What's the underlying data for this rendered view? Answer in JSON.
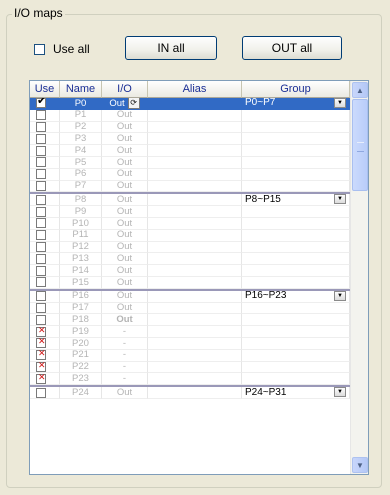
{
  "groupbox": {
    "title": "I/O maps"
  },
  "use_all": {
    "label": "Use all",
    "checked": false
  },
  "buttons": {
    "in_all": "IN all",
    "out_all": "OUT all"
  },
  "table": {
    "columns": [
      "Use",
      "Name",
      "I/O",
      "Alias",
      "Group"
    ],
    "rows": [
      {
        "use": "checked",
        "name": "P0",
        "io": "Out",
        "group": "P0~P7",
        "selected": true,
        "refresh": true
      },
      {
        "use": "empty",
        "name": "P1",
        "io": "Out"
      },
      {
        "use": "empty",
        "name": "P2",
        "io": "Out"
      },
      {
        "use": "empty",
        "name": "P3",
        "io": "Out"
      },
      {
        "use": "empty",
        "name": "P4",
        "io": "Out"
      },
      {
        "use": "empty",
        "name": "P5",
        "io": "Out"
      },
      {
        "use": "empty",
        "name": "P6",
        "io": "Out"
      },
      {
        "use": "empty",
        "name": "P7",
        "io": "Out"
      },
      {
        "use": "empty",
        "name": "P8",
        "io": "Out",
        "group": "P8~P15",
        "sep": true
      },
      {
        "use": "empty",
        "name": "P9",
        "io": "Out"
      },
      {
        "use": "empty",
        "name": "P10",
        "io": "Out"
      },
      {
        "use": "empty",
        "name": "P11",
        "io": "Out"
      },
      {
        "use": "empty",
        "name": "P12",
        "io": "Out"
      },
      {
        "use": "empty",
        "name": "P13",
        "io": "Out"
      },
      {
        "use": "empty",
        "name": "P14",
        "io": "Out"
      },
      {
        "use": "empty",
        "name": "P15",
        "io": "Out"
      },
      {
        "use": "empty",
        "name": "P16",
        "io": "Out",
        "group": "P16~P23",
        "sep": true
      },
      {
        "use": "empty",
        "name": "P17",
        "io": "Out"
      },
      {
        "use": "empty",
        "name": "P18",
        "io": "Out",
        "bold": true
      },
      {
        "use": "cross",
        "name": "P19",
        "io": "-"
      },
      {
        "use": "cross",
        "name": "P20",
        "io": "-"
      },
      {
        "use": "cross",
        "name": "P21",
        "io": "-"
      },
      {
        "use": "cross",
        "name": "P22",
        "io": "-"
      },
      {
        "use": "cross",
        "name": "P23",
        "io": "-"
      },
      {
        "use": "empty",
        "name": "P24",
        "io": "Out",
        "group": "P24~P31",
        "sep": true
      }
    ]
  },
  "scrollbar": {
    "up": "▲",
    "down": "▼"
  }
}
